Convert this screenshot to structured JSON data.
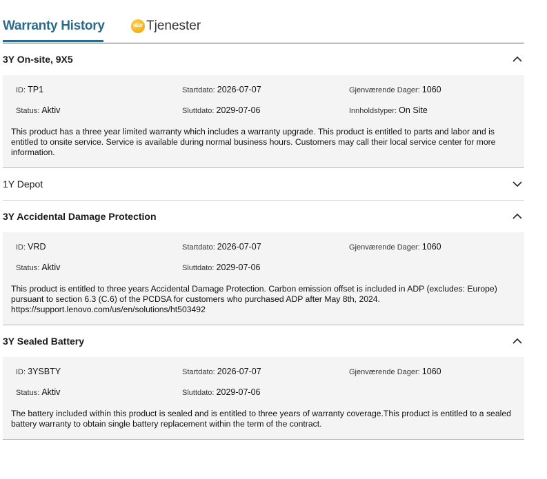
{
  "tabs": {
    "warranty_history": "Warranty History",
    "tjenester": "Tjenester",
    "new_badge": "NEW"
  },
  "labels": {
    "id": "ID",
    "status": "Status",
    "start": "Startdato",
    "end": "Sluttdato",
    "remaining": "Gjenværende Dager",
    "content_types": "Innholdstyper"
  },
  "sections": [
    {
      "title": "3Y On-site, 9X5",
      "expanded": true,
      "id": "TP1",
      "status": "Aktiv",
      "start": "2026-07-07",
      "end": "2029-07-06",
      "remaining": "1060",
      "content_types": "On Site",
      "description": "This product has a three year limited warranty which includes a warranty upgrade. This product is entitled to parts and labor and is entitled to onsite service. Service is available during normal business hours. Customers may call their local service center for more information."
    },
    {
      "title": "1Y Depot",
      "expanded": false
    },
    {
      "title": "3Y Accidental Damage Protection",
      "expanded": true,
      "id": "VRD",
      "status": "Aktiv",
      "start": "2026-07-07",
      "end": "2029-07-06",
      "remaining": "1060",
      "description": "This product is entitled to three years Accidental Damage Protection. Carbon emission offset is included in ADP (excludes: Europe) pursuant to section 6.3 (C.6) of the PCDSA for customers who purchased ADP after May 8th, 2024. https://support.lenovo.com/us/en/solutions/ht503492"
    },
    {
      "title": "3Y Sealed Battery",
      "expanded": true,
      "id": "3YSBTY",
      "status": "Aktiv",
      "start": "2026-07-07",
      "end": "2029-07-06",
      "remaining": "1060",
      "description": "The battery included within this product is sealed and is entitled to three years of warranty coverage.This product is entitled to a sealed battery warranty to obtain single battery replacement within the term of the contract."
    }
  ],
  "colors": {
    "accent": "#2a6a8c",
    "panel_bg": "#f4f4f4",
    "badge": "#f0a000"
  }
}
